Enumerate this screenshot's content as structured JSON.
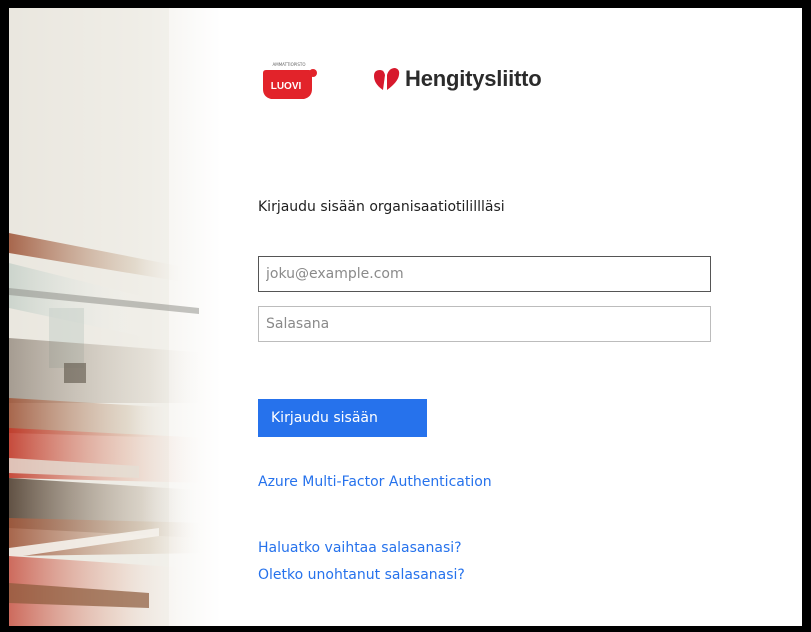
{
  "logos": {
    "luovi_text": "LUOVI",
    "luovi_small_text": "AMMATTIOPISTO",
    "hengitys_text": "Hengitysliitto"
  },
  "login": {
    "heading": "Kirjaudu sisään organisaatiotilillläsi",
    "email_placeholder": "joku@example.com",
    "password_placeholder": "Salasana",
    "signin_label": "Kirjaudu sisään",
    "mfa_link": "Azure Multi-Factor Authentication",
    "change_password_link": "Haluatko vaihtaa salasanasi?",
    "forgot_password_link": "Oletko unohtanut salasanasi?"
  },
  "colors": {
    "accent": "#2672ec",
    "luovi_red": "#e2232a",
    "hengitys_red": "#d7192d"
  }
}
